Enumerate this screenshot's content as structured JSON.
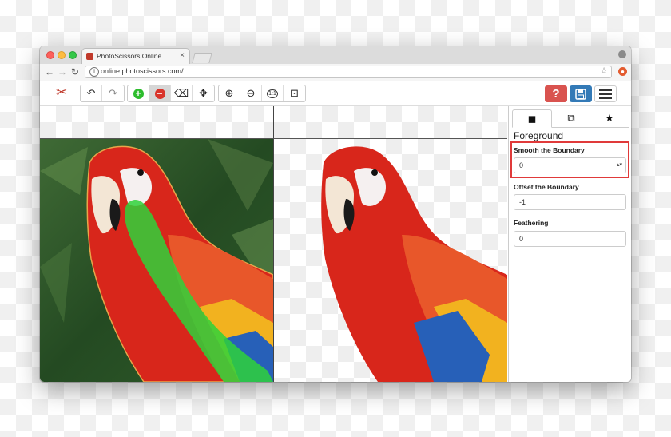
{
  "browser": {
    "tab_title": "PhotoScissors Online",
    "tab_close": "×",
    "url": "online.photoscissors.com/",
    "back": "←",
    "forward": "→",
    "reload": "↻",
    "star": "☆",
    "info": "i"
  },
  "toolbar": {
    "undo": "↶",
    "redo": "↷",
    "add_marker": "+",
    "remove_marker": "−",
    "eraser": "⌫",
    "move": "✥",
    "zoom_in": "⊕",
    "zoom_out": "⊖",
    "zoom_actual": "1:1",
    "zoom_fit": "⊡",
    "help": "?"
  },
  "panel": {
    "tabs": [
      {
        "icon": "foreground-icon",
        "glyph": "◼"
      },
      {
        "icon": "background-icon",
        "glyph": "⧉"
      },
      {
        "icon": "star-icon",
        "glyph": "★"
      }
    ],
    "title": "Foreground",
    "fields": [
      {
        "label": "Smooth the Boundary",
        "value": "0",
        "spinner": "▴▾"
      },
      {
        "label": "Offset the Boundary",
        "value": "-1"
      },
      {
        "label": "Feathering",
        "value": "0"
      }
    ]
  },
  "colors": {
    "help_button": "#d9534f",
    "save_button": "#337ab7",
    "highlight": "#e03a3a",
    "marker_green": "#2ebd2e"
  }
}
